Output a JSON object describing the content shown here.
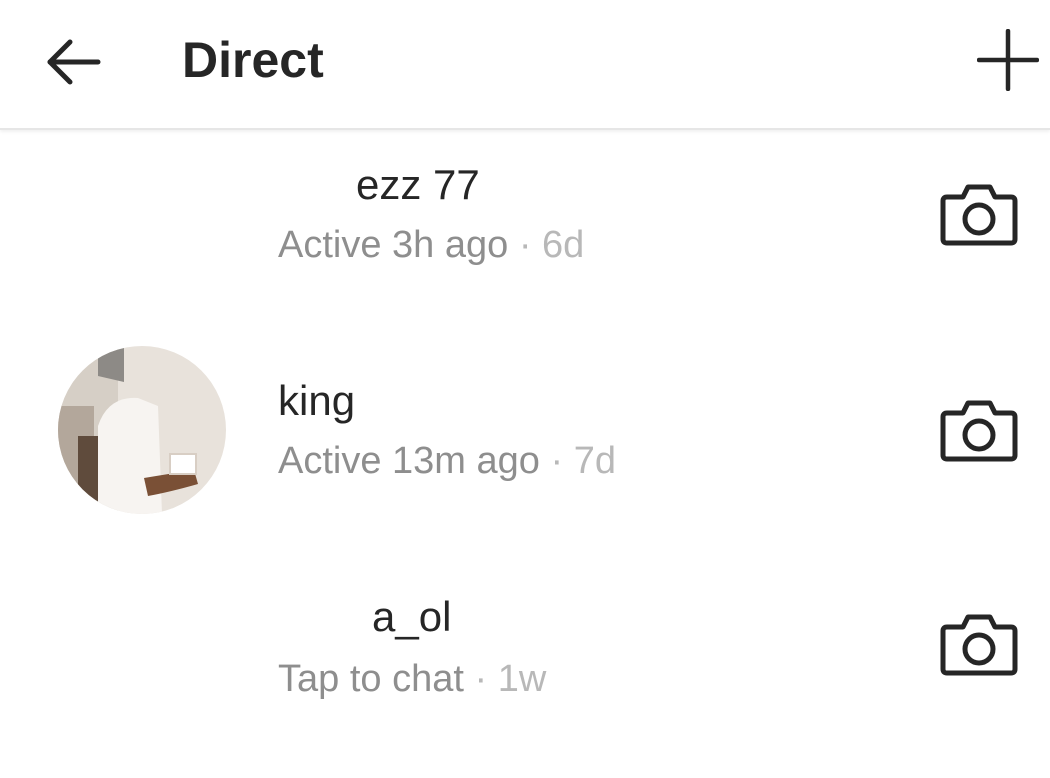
{
  "header": {
    "back_icon": "arrow-left-icon",
    "title": "Direct",
    "new_message_icon": "plus-icon"
  },
  "threads": [
    {
      "username": "ezz  77",
      "status": "Active 3h ago",
      "separator": " · ",
      "time": "6d",
      "camera_icon": "camera-icon"
    },
    {
      "username": "king",
      "status": "Active 13m ago",
      "separator": " · ",
      "time": "7d",
      "camera_icon": "camera-icon"
    },
    {
      "username": "a_ol",
      "status": "Tap to chat",
      "separator": " · ",
      "time": "1w",
      "camera_icon": "camera-icon"
    }
  ],
  "colors": {
    "text_primary": "#262626",
    "text_secondary": "#8e8e8e",
    "text_tertiary": "#b8b8b8",
    "divider": "#e6e6e6"
  }
}
